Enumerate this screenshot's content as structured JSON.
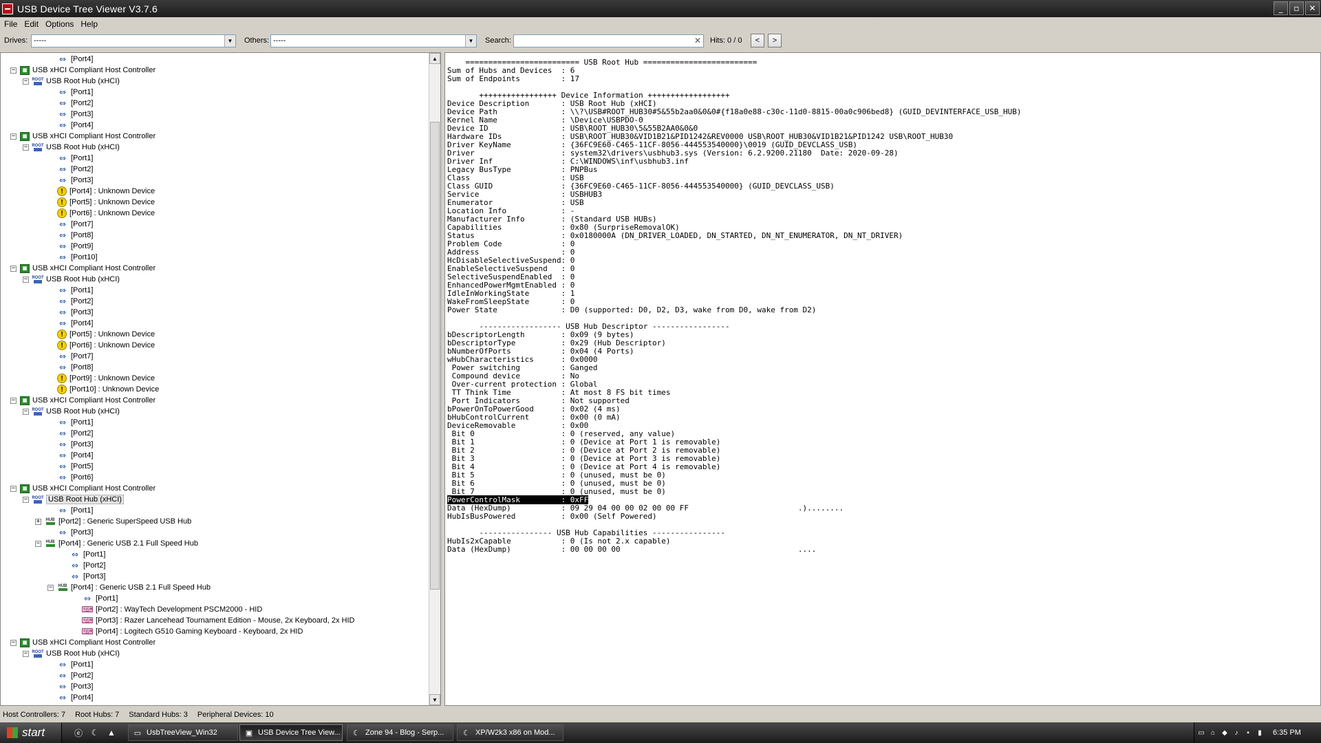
{
  "window": {
    "title": "USB Device Tree Viewer V3.7.6",
    "buttons": [
      "_",
      "▫",
      "✕"
    ]
  },
  "menu": [
    "File",
    "Edit",
    "Options",
    "Help"
  ],
  "toolbar": {
    "drives_label": "Drives:",
    "drives_value": "-----",
    "others_label": "Others:",
    "others_value": "-----",
    "search_label": "Search:",
    "search_value": "",
    "hits": "Hits: 0 / 0",
    "prev": "<",
    "next": ">"
  },
  "tree": [
    {
      "indent": 4,
      "icon": "port",
      "text": "[Port4]"
    },
    {
      "indent": 1,
      "icon": "hc",
      "exp": "-",
      "text": "USB xHCI Compliant Host Controller"
    },
    {
      "indent": 2,
      "icon": "root",
      "exp": "-",
      "text": "USB Root Hub (xHCI)"
    },
    {
      "indent": 4,
      "icon": "port",
      "text": "[Port1]"
    },
    {
      "indent": 4,
      "icon": "port",
      "text": "[Port2]"
    },
    {
      "indent": 4,
      "icon": "port",
      "text": "[Port3]"
    },
    {
      "indent": 4,
      "icon": "port",
      "text": "[Port4]"
    },
    {
      "indent": 1,
      "icon": "hc",
      "exp": "-",
      "text": "USB xHCI Compliant Host Controller"
    },
    {
      "indent": 2,
      "icon": "root",
      "exp": "-",
      "text": "USB Root Hub (xHCI)"
    },
    {
      "indent": 4,
      "icon": "port",
      "text": "[Port1]"
    },
    {
      "indent": 4,
      "icon": "port",
      "text": "[Port2]"
    },
    {
      "indent": 4,
      "icon": "port",
      "text": "[Port3]"
    },
    {
      "indent": 4,
      "icon": "warn",
      "text": "[Port4] : Unknown Device"
    },
    {
      "indent": 4,
      "icon": "warn",
      "text": "[Port5] : Unknown Device"
    },
    {
      "indent": 4,
      "icon": "warn",
      "text": "[Port6] : Unknown Device"
    },
    {
      "indent": 4,
      "icon": "port",
      "text": "[Port7]"
    },
    {
      "indent": 4,
      "icon": "port",
      "text": "[Port8]"
    },
    {
      "indent": 4,
      "icon": "port",
      "text": "[Port9]"
    },
    {
      "indent": 4,
      "icon": "port",
      "text": "[Port10]"
    },
    {
      "indent": 1,
      "icon": "hc",
      "exp": "-",
      "text": "USB xHCI Compliant Host Controller"
    },
    {
      "indent": 2,
      "icon": "root",
      "exp": "-",
      "text": "USB Root Hub (xHCI)"
    },
    {
      "indent": 4,
      "icon": "port",
      "text": "[Port1]"
    },
    {
      "indent": 4,
      "icon": "port",
      "text": "[Port2]"
    },
    {
      "indent": 4,
      "icon": "port",
      "text": "[Port3]"
    },
    {
      "indent": 4,
      "icon": "port",
      "text": "[Port4]"
    },
    {
      "indent": 4,
      "icon": "warn",
      "text": "[Port5] : Unknown Device"
    },
    {
      "indent": 4,
      "icon": "warn",
      "text": "[Port6] : Unknown Device"
    },
    {
      "indent": 4,
      "icon": "port",
      "text": "[Port7]"
    },
    {
      "indent": 4,
      "icon": "port",
      "text": "[Port8]"
    },
    {
      "indent": 4,
      "icon": "warn",
      "text": "[Port9] : Unknown Device"
    },
    {
      "indent": 4,
      "icon": "warn",
      "text": "[Port10] : Unknown Device"
    },
    {
      "indent": 1,
      "icon": "hc",
      "exp": "-",
      "text": "USB xHCI Compliant Host Controller"
    },
    {
      "indent": 2,
      "icon": "root",
      "exp": "-",
      "text": "USB Root Hub (xHCI)"
    },
    {
      "indent": 4,
      "icon": "port",
      "text": "[Port1]"
    },
    {
      "indent": 4,
      "icon": "port",
      "text": "[Port2]"
    },
    {
      "indent": 4,
      "icon": "port",
      "text": "[Port3]"
    },
    {
      "indent": 4,
      "icon": "port",
      "text": "[Port4]"
    },
    {
      "indent": 4,
      "icon": "port",
      "text": "[Port5]"
    },
    {
      "indent": 4,
      "icon": "port",
      "text": "[Port6]"
    },
    {
      "indent": 1,
      "icon": "hc",
      "exp": "-",
      "text": "USB xHCI Compliant Host Controller"
    },
    {
      "indent": 2,
      "icon": "root",
      "exp": "-",
      "text": "USB Root Hub (xHCI)",
      "selected": true
    },
    {
      "indent": 4,
      "icon": "port",
      "text": "[Port1]"
    },
    {
      "indent": 3,
      "icon": "hub",
      "exp": "+",
      "text": "[Port2] : Generic SuperSpeed USB Hub"
    },
    {
      "indent": 4,
      "icon": "port",
      "text": "[Port3]"
    },
    {
      "indent": 3,
      "icon": "hub",
      "exp": "-",
      "text": "[Port4] : Generic USB 2.1 Full Speed Hub"
    },
    {
      "indent": 5,
      "icon": "port",
      "text": "[Port1]"
    },
    {
      "indent": 5,
      "icon": "port",
      "text": "[Port2]"
    },
    {
      "indent": 5,
      "icon": "port",
      "text": "[Port3]"
    },
    {
      "indent": 4,
      "icon": "hub",
      "exp": "-",
      "text": "[Port4] : Generic USB 2.1 Full Speed Hub"
    },
    {
      "indent": 6,
      "icon": "port",
      "text": "[Port1]"
    },
    {
      "indent": 6,
      "icon": "hid",
      "text": "[Port2] : WayTech Development PSCM2000 - HID"
    },
    {
      "indent": 6,
      "icon": "hid",
      "text": "[Port3] : Razer Lancehead Tournament Edition - Mouse, 2x Keyboard, 2x HID"
    },
    {
      "indent": 6,
      "icon": "hid",
      "text": "[Port4] : Logitech G510 Gaming Keyboard - Keyboard, 2x HID"
    },
    {
      "indent": 1,
      "icon": "hc",
      "exp": "-",
      "text": "USB xHCI Compliant Host Controller"
    },
    {
      "indent": 2,
      "icon": "root",
      "exp": "-",
      "text": "USB Root Hub (xHCI)"
    },
    {
      "indent": 4,
      "icon": "port",
      "text": "[Port1]"
    },
    {
      "indent": 4,
      "icon": "port",
      "text": "[Port2]"
    },
    {
      "indent": 4,
      "icon": "port",
      "text": "[Port3]"
    },
    {
      "indent": 4,
      "icon": "port",
      "text": "[Port4]"
    }
  ],
  "icons": {
    "hc": "host-controller-icon",
    "root": "root-hub-icon",
    "port": "usb-port-icon",
    "warn": "warning-icon",
    "hub": "hub-icon",
    "hid": "hid-device-icon"
  },
  "details": [
    "    ========================= USB Root Hub =========================",
    "Sum of Hubs and Devices  : 6",
    "Sum of Endpoints         : 17",
    "",
    "       +++++++++++++++++ Device Information ++++++++++++++++++",
    "Device Description       : USB Root Hub (xHCI)",
    "Device Path              : \\\\?\\USB#ROOT_HUB30#5&55b2aa0&0&0#{f18a0e88-c30c-11d0-8815-00a0c906bed8} (GUID_DEVINTERFACE_USB_HUB)",
    "Kernel Name              : \\Device\\USBPDO-0",
    "Device ID                : USB\\ROOT_HUB30\\5&55B2AA0&0&0",
    "Hardware IDs             : USB\\ROOT_HUB30&VID1B21&PID1242&REV0000 USB\\ROOT_HUB30&VID1B21&PID1242 USB\\ROOT_HUB30",
    "Driver KeyName           : {36FC9E60-C465-11CF-8056-444553540000}\\0019 (GUID_DEVCLASS_USB)",
    "Driver                   : system32\\drivers\\usbhub3.sys (Version: 6.2.9200.21180  Date: 2020-09-28)",
    "Driver Inf               : C:\\WINDOWS\\inf\\usbhub3.inf",
    "Legacy BusType           : PNPBus",
    "Class                    : USB",
    "Class GUID               : {36FC9E60-C465-11CF-8056-444553540000} (GUID_DEVCLASS_USB)",
    "Service                  : USBHUB3",
    "Enumerator               : USB",
    "Location Info            : -",
    "Manufacturer Info        : (Standard USB HUBs)",
    "Capabilities             : 0x80 (SurpriseRemovalOK)",
    "Status                   : 0x0180000A (DN_DRIVER_LOADED, DN_STARTED, DN_NT_ENUMERATOR, DN_NT_DRIVER)",
    "Problem Code             : 0",
    "Address                  : 0",
    "HcDisableSelectiveSuspend: 0",
    "EnableSelectiveSuspend   : 0",
    "SelectiveSuspendEnabled  : 0",
    "EnhancedPowerMgmtEnabled : 0",
    "IdleInWorkingState       : 1",
    "WakeFromSleepState       : 0",
    "Power State              : D0 (supported: D0, D2, D3, wake from D0, wake from D2)",
    "",
    "       ------------------ USB Hub Descriptor -----------------",
    "bDescriptorLength        : 0x09 (9 bytes)",
    "bDescriptorType          : 0x29 (Hub Descriptor)",
    "bNumberOfPorts           : 0x04 (4 Ports)",
    "wHubCharacteristics      : 0x0000",
    " Power switching         : Ganged",
    " Compound device         : No",
    " Over-current protection : Global",
    " TT Think Time           : At most 8 FS bit times",
    " Port Indicators         : Not supported",
    "bPowerOnToPowerGood      : 0x02 (4 ms)",
    "bHubControlCurrent       : 0x00 (0 mA)",
    "DeviceRemovable          : 0x00",
    " Bit 0                   : 0 (reserved, any value)",
    " Bit 1                   : 0 (Device at Port 1 is removable)",
    " Bit 2                   : 0 (Device at Port 2 is removable)",
    " Bit 3                   : 0 (Device at Port 3 is removable)",
    " Bit 4                   : 0 (Device at Port 4 is removable)",
    " Bit 5                   : 0 (unused, must be 0)",
    " Bit 6                   : 0 (unused, must be 0)",
    " Bit 7                   : 0 (unused, must be 0)",
    "PowerControlMask         : 0xFF",
    "Data (HexDump)           : 09 29 04 00 00 02 00 00 FF                        .)........",
    "HubIsBusPowered          : 0x00 (Self Powered)",
    "",
    "       ---------------- USB Hub Capabilities ----------------",
    "HubIs2xCapable           : 0 (Is not 2.x capable)",
    "Data (HexDump)           : 00 00 00 00                                       ...."
  ],
  "highlight_line": 53,
  "status": {
    "host_controllers": "Host Controllers: 7",
    "root_hubs": "Root Hubs: 7",
    "standard_hubs": "Standard Hubs: 3",
    "peripheral_devices": "Peripheral Devices: 10"
  },
  "taskbar": {
    "start": "start",
    "tasks": [
      {
        "label": "UsbTreeView_Win32",
        "icon": "folder-icon",
        "active": false
      },
      {
        "label": "USB Device Tree View...",
        "icon": "usbtreeview-icon",
        "active": true
      },
      {
        "label": "Zone 94 - Blog - Serp...",
        "icon": "browser-icon",
        "active": false
      },
      {
        "label": "XP/W2k3 x86 on Mod...",
        "icon": "browser-icon",
        "active": false
      }
    ],
    "clock": "6:35 PM"
  }
}
